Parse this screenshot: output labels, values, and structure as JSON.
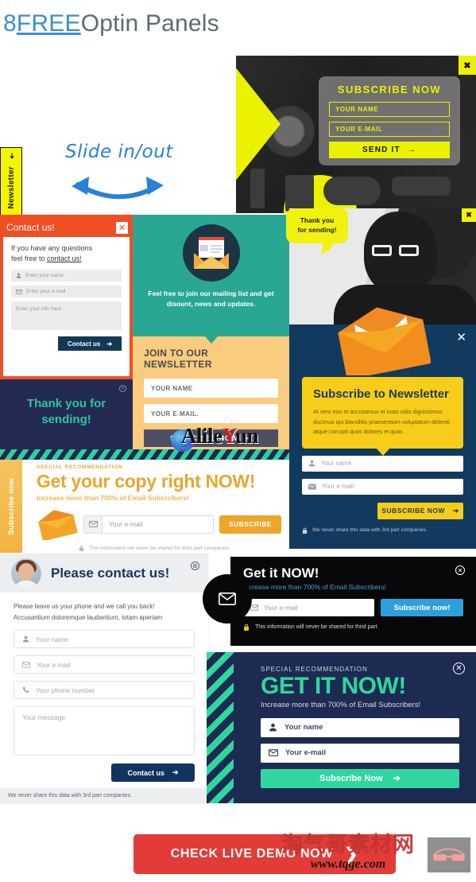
{
  "title": {
    "num": "8 ",
    "free": "FREE",
    "rest": " Optin Panels"
  },
  "slide_demo": {
    "tab_label": "Newsletter",
    "tab_arrow": "➜",
    "annotation": "Slide in/out"
  },
  "photo_subscribe": {
    "close": "✖",
    "heading": "SUBSCRIBE NOW",
    "name_placeholder": "YOUR NAME",
    "email_placeholder": "YOUR E-MAIL",
    "button": "SEND IT",
    "button_arrow": "→"
  },
  "contact_orange": {
    "title": "Contact us!",
    "close": "✕",
    "lead_1": "If you have any questions",
    "lead_2": "feel free to ",
    "lead_link": "contact us!",
    "name_placeholder": "Enter your name",
    "email_placeholder": "Enter your e-mail",
    "info_placeholder": "Enter your info here",
    "button": "Contact us",
    "button_arrow": "➔"
  },
  "thanks_navy": {
    "close": "×",
    "line1": "Thank you for",
    "line2": "sending!"
  },
  "teal_join": {
    "message": "Feel free to join our mailing list and get disount, news and updates.",
    "heading": "JOIN TO OUR NEWSLETTER",
    "name_placeholder": "YOUR NAME",
    "email_placeholder": "YOUR E-MAIL.",
    "button": "SUBSCRIBE NOW",
    "button_arrow": "➜"
  },
  "man_panel": {
    "bubble_line1": "Thank you",
    "bubble_line2": "for sending!",
    "close": "✖"
  },
  "navy_newsletter": {
    "close": "✕",
    "heading": "Subscribe to Newsletter",
    "paragraph": "At vero eos et accusamus et iusto odio dignissimos ducimus qui blanditiis praesentium voluptatum deleniti atque corrupti quos dolores et quas",
    "name_placeholder": "Your name",
    "email_placeholder": "Your e-mail",
    "button": "SUBSCRIBE NOW",
    "button_arrow": "➔",
    "note": "We never share this data with 3rd part companies."
  },
  "copy_panel": {
    "tab_label": "Subscribe now",
    "kicker": "SPECIAL RECOMMENDATION",
    "heading": "Get your copy right NOW!",
    "sub": "Increase more than 700% of Email Subscribers!",
    "email_placeholder": "Your e-mail",
    "button": "SUBSCRIBE",
    "note": "This information will never be shared for third part companies"
  },
  "please_contact": {
    "title": "Please contact us!",
    "close": "⊗",
    "lead_1": "Please leave us your phone and we call you back!",
    "lead_2": "Accusantium doloremque laudantium, totam aperiam",
    "name_placeholder": "Your name",
    "email_placeholder": "Your e-mail",
    "phone_placeholder": "Your phone number",
    "message_placeholder": "Your message",
    "button": "Contact us",
    "button_arrow": "➔",
    "footer": "We never share this data with 3rd part companies."
  },
  "get_it_black": {
    "close": "✕",
    "heading": "Get it NOW!",
    "sub": "Increase more than 700% of Email Subscribers!",
    "email_placeholder": "Your e-mail",
    "button": "Subscribe now!",
    "note": "This information will never be shared for third part"
  },
  "get_it_navy": {
    "close": "✕",
    "kicker": "SPECIAL RECOMMENDATION",
    "heading": "GET IT NOW!",
    "sub": "Increase more than 700% of Email Subscribers!",
    "name_placeholder": "Your name",
    "email_placeholder": "Your e-mail",
    "button": "Subscribe Now",
    "button_arrow": "➔"
  },
  "cta": {
    "label": "CHECK LIVE DEMO NOW",
    "chevron": "❯"
  },
  "watermarks": {
    "alile_a": "Alile",
    "alile_y": "Y",
    "alile_un": "un",
    "cn_text": "淘气哥素材网",
    "cn_url": "www.tqge.com"
  },
  "colors": {
    "yellow": "#f5f500",
    "orange": "#f04e23",
    "teal": "#29a793",
    "navy": "#123a5e",
    "green": "#2fd79e",
    "blue": "#2e9fdd",
    "red": "#e23b38",
    "gold": "#eda627"
  }
}
